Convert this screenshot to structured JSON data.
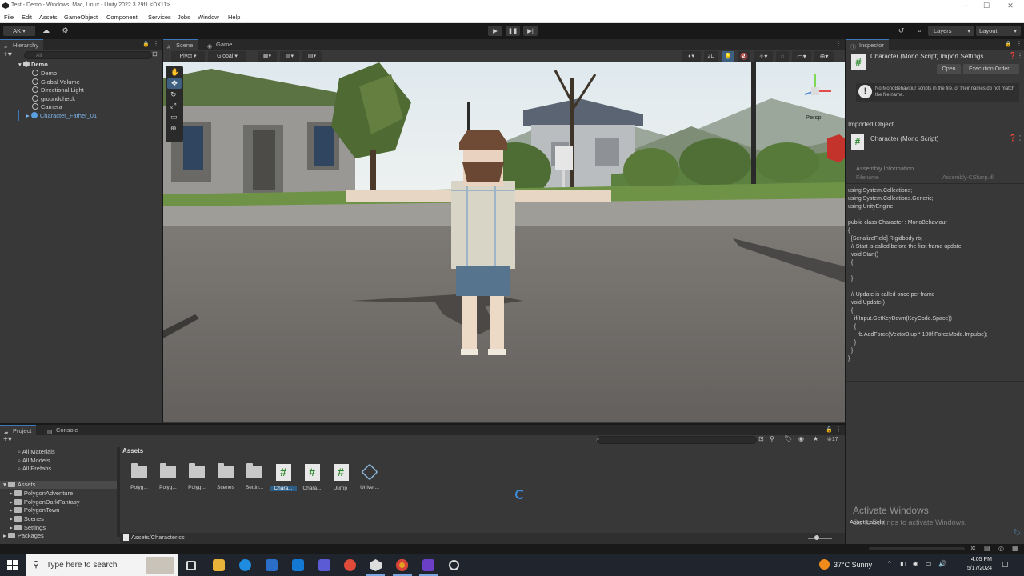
{
  "window": {
    "title": "Test - Demo - Windows, Mac, Linux - Unity 2022.3.29f1 <DX11>",
    "controls": [
      "─",
      "☐",
      "✕"
    ]
  },
  "menu": [
    "File",
    "Edit",
    "Assets",
    "GameObject",
    "Component",
    "Services",
    "Jobs",
    "Window",
    "Help"
  ],
  "toolbar": {
    "account": "AK ▾",
    "layers": "Layers",
    "layout": "Layout"
  },
  "hierarchy": {
    "tab": "Hierarchy",
    "search_placeholder": "All",
    "scene": "Demo",
    "items": [
      "Demo",
      "Global Volume",
      "Directional Light",
      "groundcheck",
      "Camera",
      "Character_Father_01"
    ]
  },
  "scene_view": {
    "tabs": [
      "Scene",
      "Game"
    ],
    "pivot": "Pivot",
    "global": "Global",
    "mode_2d": "2D",
    "persp": "Persp"
  },
  "inspector": {
    "tab": "Inspector",
    "header": "Character (Mono Script) Import Settings",
    "open": "Open",
    "execution_order": "Execution Order...",
    "warning": "No MonoBehaviour scripts in the file, or their names do not match the file name.",
    "imported_object": "Imported Object",
    "script_name": "Character (Mono Script)",
    "assembly_info": "Assembly Information",
    "filename_label": "Filename",
    "filename_value": "Assembly-CSharp.dll",
    "code": [
      "using System.Collections;",
      "using System.Collections.Generic;",
      "using UnityEngine;",
      "",
      "public class Character : MonoBehaviour",
      "{",
      "  [SerializeField] Rigidbody rb;",
      "  // Start is called before the first frame update",
      "  void Start()",
      "  {",
      "",
      "  }",
      "",
      "  // Update is called once per frame",
      "  void Update()",
      "  {",
      "    if(Input.GetKeyDown(KeyCode.Space))",
      "    {",
      "      rb.AddForce(Vector3.up * 100f,ForceMode.Impulse);",
      "    }",
      "  }",
      "}"
    ],
    "asset_labels": "Asset Labels",
    "activate_title": "Activate Windows",
    "activate_sub": "Go to Settings to activate Windows."
  },
  "project": {
    "tabs": [
      "Project",
      "Console"
    ],
    "favorites": [
      "All Materials",
      "All Models",
      "All Prefabs"
    ],
    "assets_root": "Assets",
    "folders": [
      "PolygonAdventure",
      "PolygonDarkFantasy",
      "PolygonTown",
      "Scenes",
      "Settings"
    ],
    "packages": "Packages",
    "breadcrumb": "Assets",
    "path": "Assets/Character.cs",
    "count": "17",
    "grid": [
      {
        "label": "Polyg...",
        "kind": "folder"
      },
      {
        "label": "Polyg...",
        "kind": "folder"
      },
      {
        "label": "Polyg...",
        "kind": "folder"
      },
      {
        "label": "Scenes",
        "kind": "folder"
      },
      {
        "label": "Settin...",
        "kind": "folder"
      },
      {
        "label": "Chara...",
        "kind": "script",
        "selected": true
      },
      {
        "label": "Chara...",
        "kind": "script"
      },
      {
        "label": "Jump",
        "kind": "script"
      },
      {
        "label": "Univer...",
        "kind": "package"
      }
    ]
  },
  "taskbar": {
    "search_placeholder": "Type here to search",
    "weather": "37°C  Sunny",
    "time": "4:05 PM",
    "date": "5/17/2024"
  },
  "colors": {
    "panel": "#383838",
    "dark": "#282828",
    "selection": "#2c5d87",
    "accent": "#3a79bb",
    "script_green": "#2d8a2d"
  }
}
